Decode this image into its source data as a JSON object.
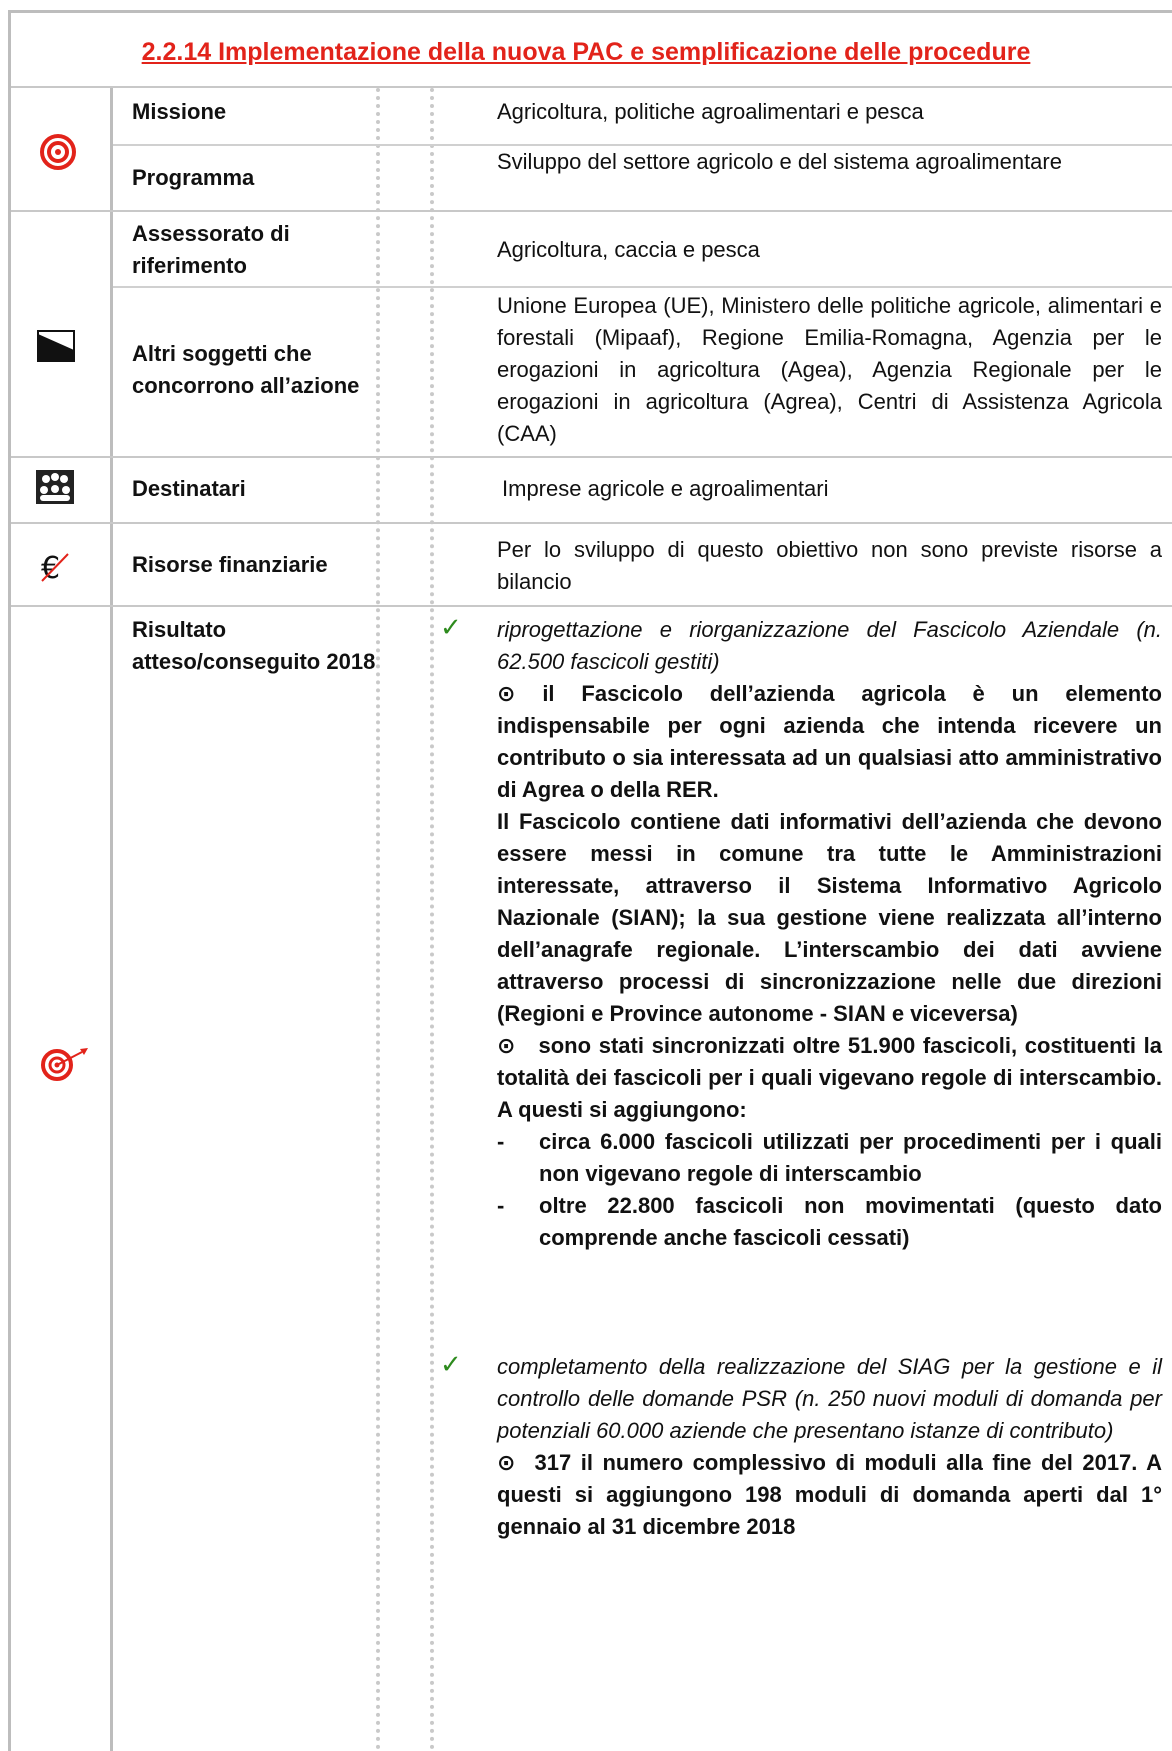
{
  "title": "2.2.14 Implementazione della nuova PAC e semplificazione delle procedure",
  "rows": {
    "missione": {
      "label": "Missione",
      "value": "Agricoltura, politiche agroalimentari e pesca"
    },
    "programma": {
      "label": "Programma",
      "value": "Sviluppo del settore agricolo e del sistema agroalimentare"
    },
    "assessorato": {
      "label": "Assessorato di riferimento",
      "value": "Agricoltura, caccia e pesca"
    },
    "altri": {
      "label": "Altri soggetti che concorrono all’azione",
      "value": "Unione Europea (UE), Ministero delle politiche agricole, alimentari e forestali (Mipaaf), Regione Emilia-Romagna, Agenzia per le erogazioni in agricoltura (Agea), Agenzia Regionale per le erogazioni in agricoltura (Agrea), Centri di Assistenza Agricola (CAA)"
    },
    "destinatari": {
      "label": "Destinatari",
      "value": "Imprese agricole e agroalimentari"
    },
    "risorse": {
      "label": "Risorse finanziarie",
      "value": "Per lo sviluppo di questo obiettivo non sono previste risorse a bilancio"
    },
    "risultato": {
      "label": "Risultato atteso/conseguito 2018",
      "check_symbol": "✓",
      "bullet": "⊙",
      "item1_italic": "riprogettazione e riorganizzazione del Fascicolo Aziendale (n. 62.500 fascicoli gestiti)",
      "item1_p1": "il Fascicolo dell’azienda agricola è un elemento indispensabile per ogni azienda che intenda ricevere un contributo o sia interessata ad un qualsiasi atto amministrativo di Agrea o della RER.",
      "item1_p2": "Il Fascicolo contiene dati informativi dell’azienda che devono essere messi in comune tra tutte le Amministrazioni interessate, attraverso il Sistema Informativo Agricolo Nazionale (SIAN); la sua gestione viene realizzata all’interno dell’anagrafe regionale. L’interscambio dei dati avviene attraverso processi di sincronizzazione nelle due direzioni (Regioni e Province autonome - SIAN e viceversa)",
      "item1_p3": "sono stati sincronizzati oltre 51.900 fascicoli, costituenti la totalità dei fascicoli per i quali vigevano regole di interscambio.  A questi si aggiungono:",
      "dash_symbol": "-",
      "dash1": "circa 6.000 fascicoli utilizzati per procedimenti per i quali non vigevano regole di interscambio",
      "dash2": "oltre 22.800 fascicoli non movimentati (questo dato comprende anche fascicoli cessati)",
      "item2_italic": "completamento della realizzazione del SIAG per la gestione e il controllo delle domande PSR (n. 250 nuovi moduli di domanda per potenziali 60.000 aziende che presentano istanze di contributo)",
      "item2_p1": "317 il numero complessivo di moduli alla fine del 2017. A questi si aggiungono 198 moduli di domanda aperti dal 1° gennaio al 31 dicembre 2018"
    }
  },
  "icons": [
    "target-icon",
    "mountain-flag-icon",
    "people-group-icon",
    "euro-crossed-icon",
    "dart-target-icon"
  ]
}
